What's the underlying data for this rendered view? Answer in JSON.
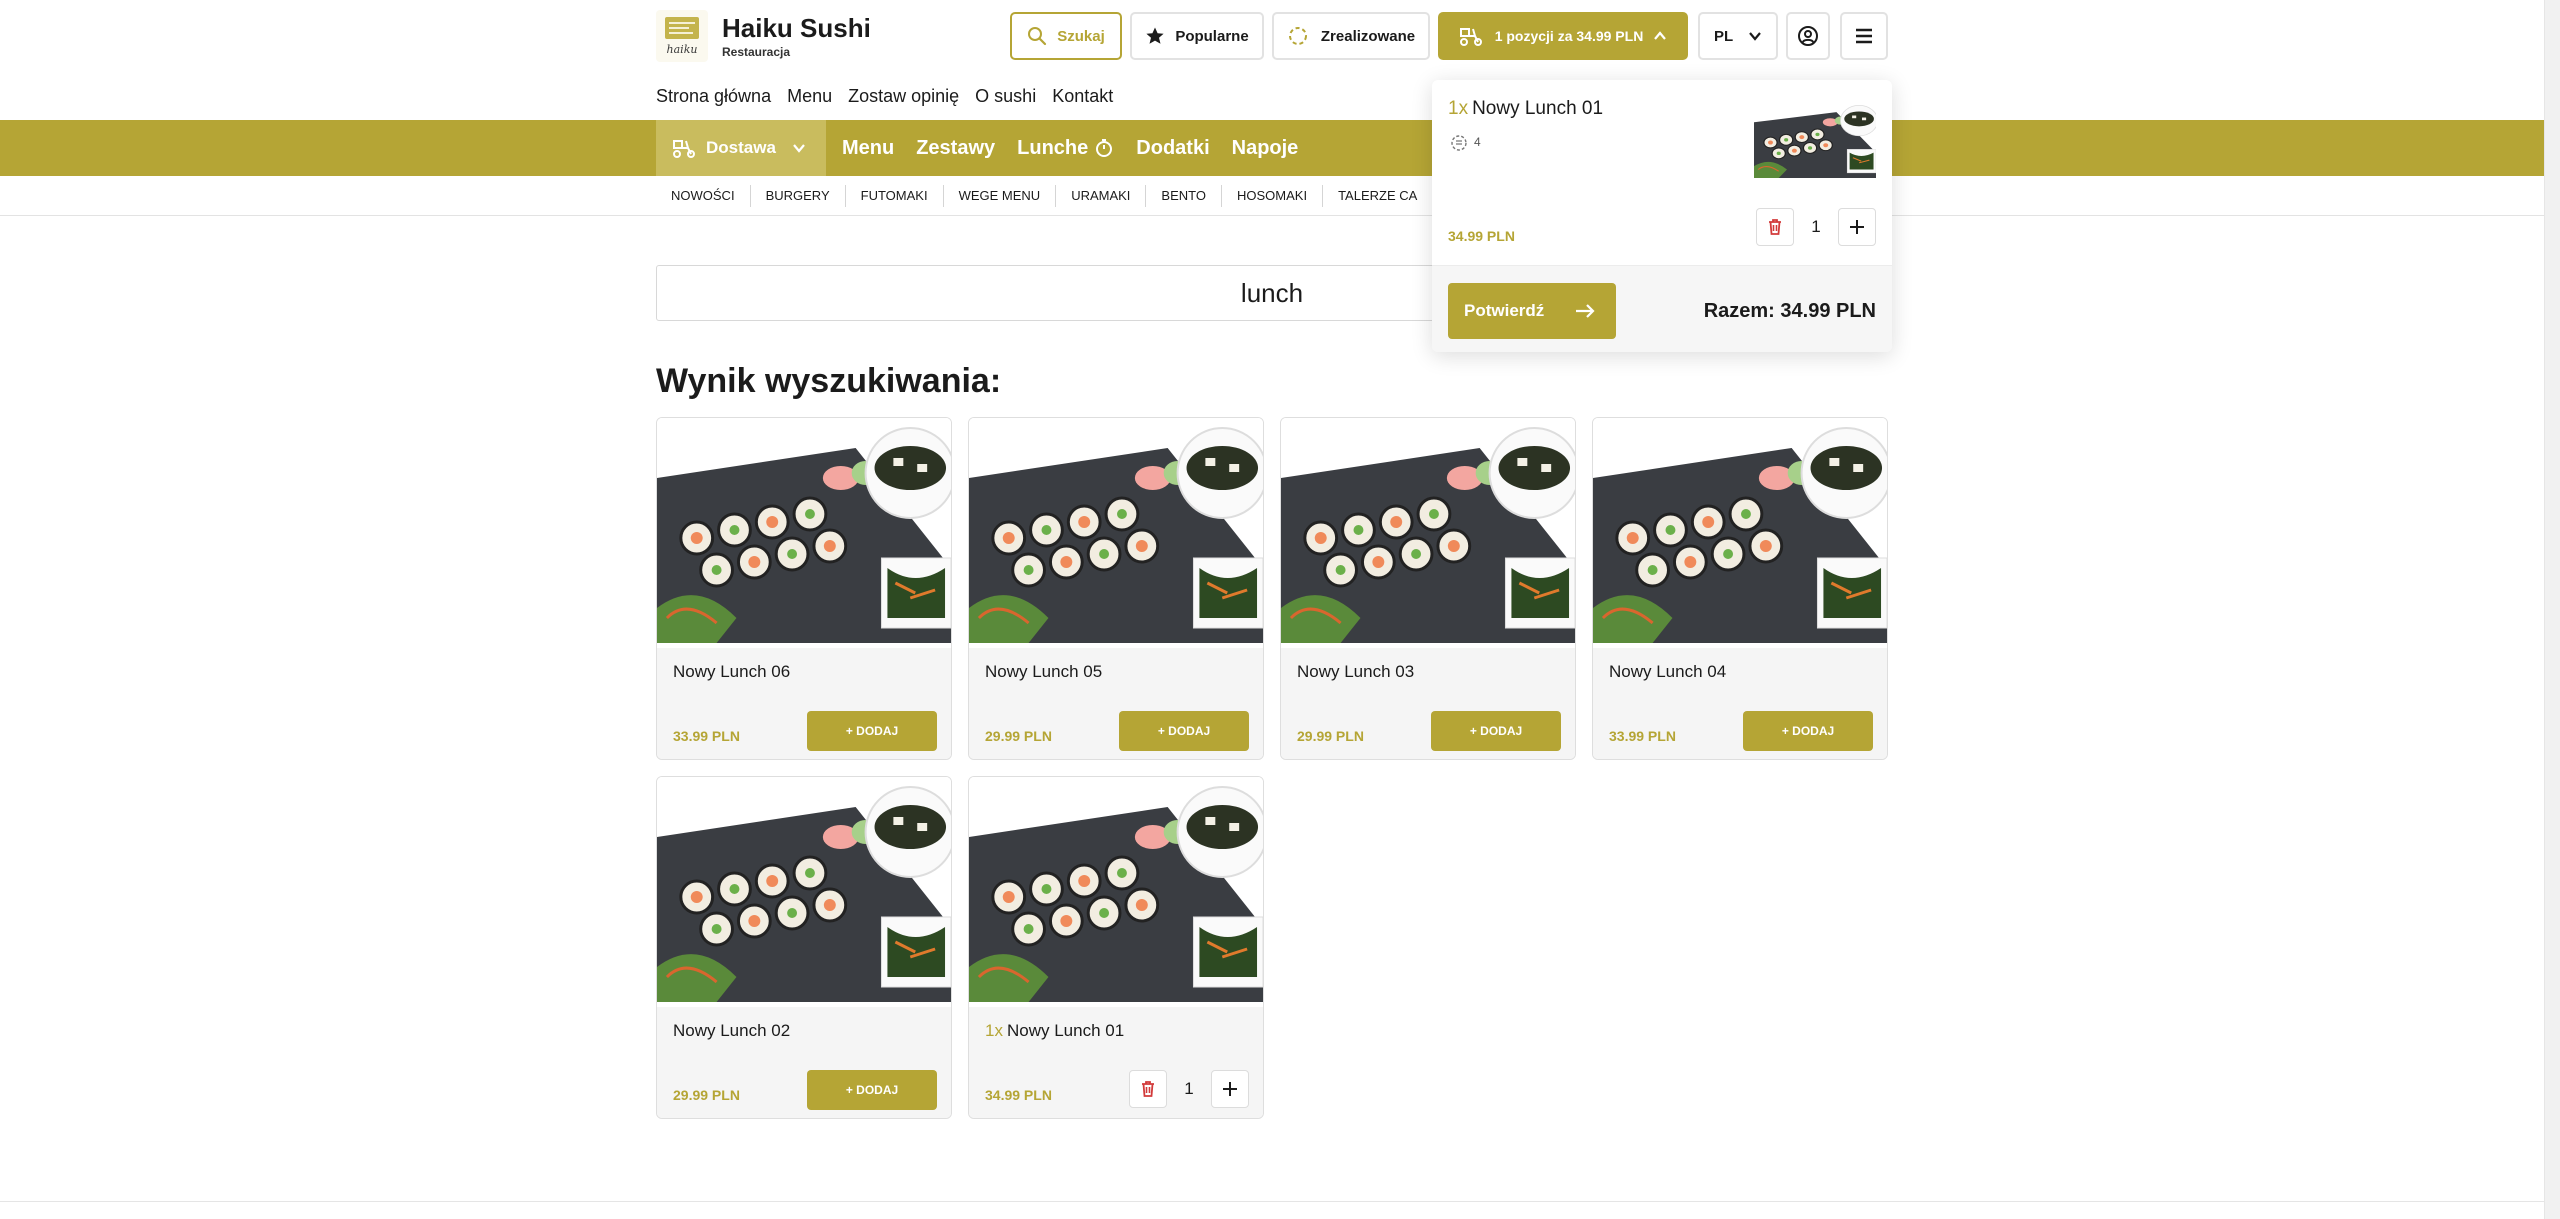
{
  "header": {
    "brand_title": "Haiku Sushi",
    "brand_sub": "Restauracja",
    "logo_text": "haiku",
    "search_label": "Szukaj",
    "popular_label": "Popularne",
    "done_label": "Zrealizowane",
    "cart_label": "1 pozycji za 34.99 PLN",
    "lang_label": "PL",
    "accent_color": "#b5a535"
  },
  "topnav": [
    "Strona główna",
    "Menu",
    "Zostaw opinię",
    "O sushi",
    "Kontakt"
  ],
  "catbar": {
    "delivery_label": "Dostawa",
    "links": [
      "Menu",
      "Zestawy",
      "Lunche",
      "Dodatki",
      "Napoje"
    ]
  },
  "subnav": [
    "NOWOŚCI",
    "BURGERY",
    "FUTOMAKI",
    "WEGE MENU",
    "URAMAKI",
    "BENTO",
    "HOSOMAKI",
    "TALERZE CA"
  ],
  "search": {
    "query": "lunch"
  },
  "results_title": "Wynik wyszukiwania:",
  "add_label": "DODAJ",
  "products": [
    {
      "name": "Nowy Lunch 06",
      "price": "33.99 PLN"
    },
    {
      "name": "Nowy Lunch 05",
      "price": "29.99 PLN"
    },
    {
      "name": "Nowy Lunch 03",
      "price": "29.99 PLN"
    },
    {
      "name": "Nowy Lunch 04",
      "price": "33.99 PLN"
    },
    {
      "name": "Nowy Lunch 02",
      "price": "29.99 PLN"
    },
    {
      "name": "Nowy Lunch 01",
      "price": "34.99 PLN",
      "qty_prefix": "1x",
      "qty": "1"
    }
  ],
  "cart": {
    "item_qty_prefix": "1x",
    "item_name": "Nowy Lunch 01",
    "item_icon_count": "4",
    "item_price": "34.99 PLN",
    "item_qty": "1",
    "confirm_label": "Potwierdź",
    "total_label": "Razem: 34.99 PLN"
  }
}
